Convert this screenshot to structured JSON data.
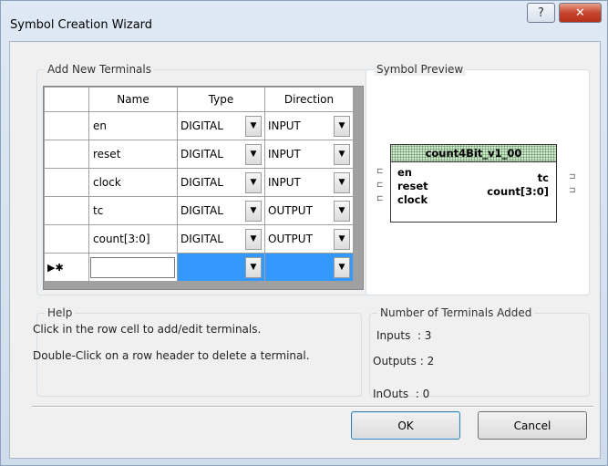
{
  "window": {
    "title": "Symbol Creation Wizard",
    "help_glyph": "?",
    "close_glyph": "✕"
  },
  "terminals_group": {
    "legend": "Add New Terminals",
    "columns": [
      "Name",
      "Type",
      "Direction"
    ],
    "rows": [
      {
        "name": "en",
        "type": "DIGITAL",
        "direction": "INPUT"
      },
      {
        "name": "reset",
        "type": "DIGITAL",
        "direction": "INPUT"
      },
      {
        "name": "clock",
        "type": "DIGITAL",
        "direction": "INPUT"
      },
      {
        "name": "tc",
        "type": "DIGITAL",
        "direction": "OUTPUT"
      },
      {
        "name": "count[3:0]",
        "type": "DIGITAL",
        "direction": "OUTPUT"
      }
    ],
    "new_row_marker": "▶✱"
  },
  "preview_group": {
    "legend": "Symbol Preview",
    "symbol_name": "count4Bit_v1_00",
    "inputs": [
      "en",
      "reset",
      "clock"
    ],
    "outputs": [
      "tc",
      "count[3:0]"
    ]
  },
  "help_group": {
    "legend": "Help",
    "lines": [
      "Click in the row cell to add/edit terminals.",
      "Double-Click on a row header to delete a terminal."
    ]
  },
  "count_group": {
    "legend": "Number of Terminals Added",
    "inputs": "Inputs  : 3",
    "outputs": "Outputs : 2",
    "inouts": "InOuts  : 0"
  },
  "buttons": {
    "ok": "OK",
    "cancel": "Cancel"
  }
}
